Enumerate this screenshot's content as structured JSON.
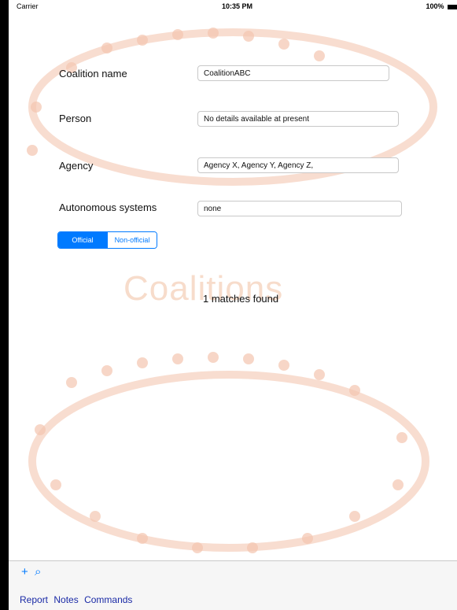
{
  "status_bar": {
    "carrier": "Carrier",
    "time": "10:35 PM",
    "battery": "100%"
  },
  "watermark": {
    "title": "Coalitions"
  },
  "form": {
    "coalition_name": {
      "label": "Coalition name",
      "value": "CoalitionABC"
    },
    "person": {
      "label": "Person",
      "value": "No details available at present"
    },
    "agency": {
      "label": "Agency",
      "value": "Agency X, Agency Y, Agency Z,"
    },
    "autonomous": {
      "label": "Autonomous systems",
      "value": "none"
    }
  },
  "segment": {
    "options": [
      "Official",
      "Non-official"
    ],
    "selected": "Official"
  },
  "results": {
    "text": "1 matches found"
  },
  "toolbar": {
    "icons": [
      "plus-icon",
      "search-icon"
    ],
    "plus_glyph": "+",
    "search_glyph": "⌕",
    "links": [
      "Report",
      "Notes",
      "Commands"
    ]
  },
  "colors": {
    "accent": "#007aff",
    "link": "#1a2aa6",
    "watermark": "#f3c9b8"
  }
}
